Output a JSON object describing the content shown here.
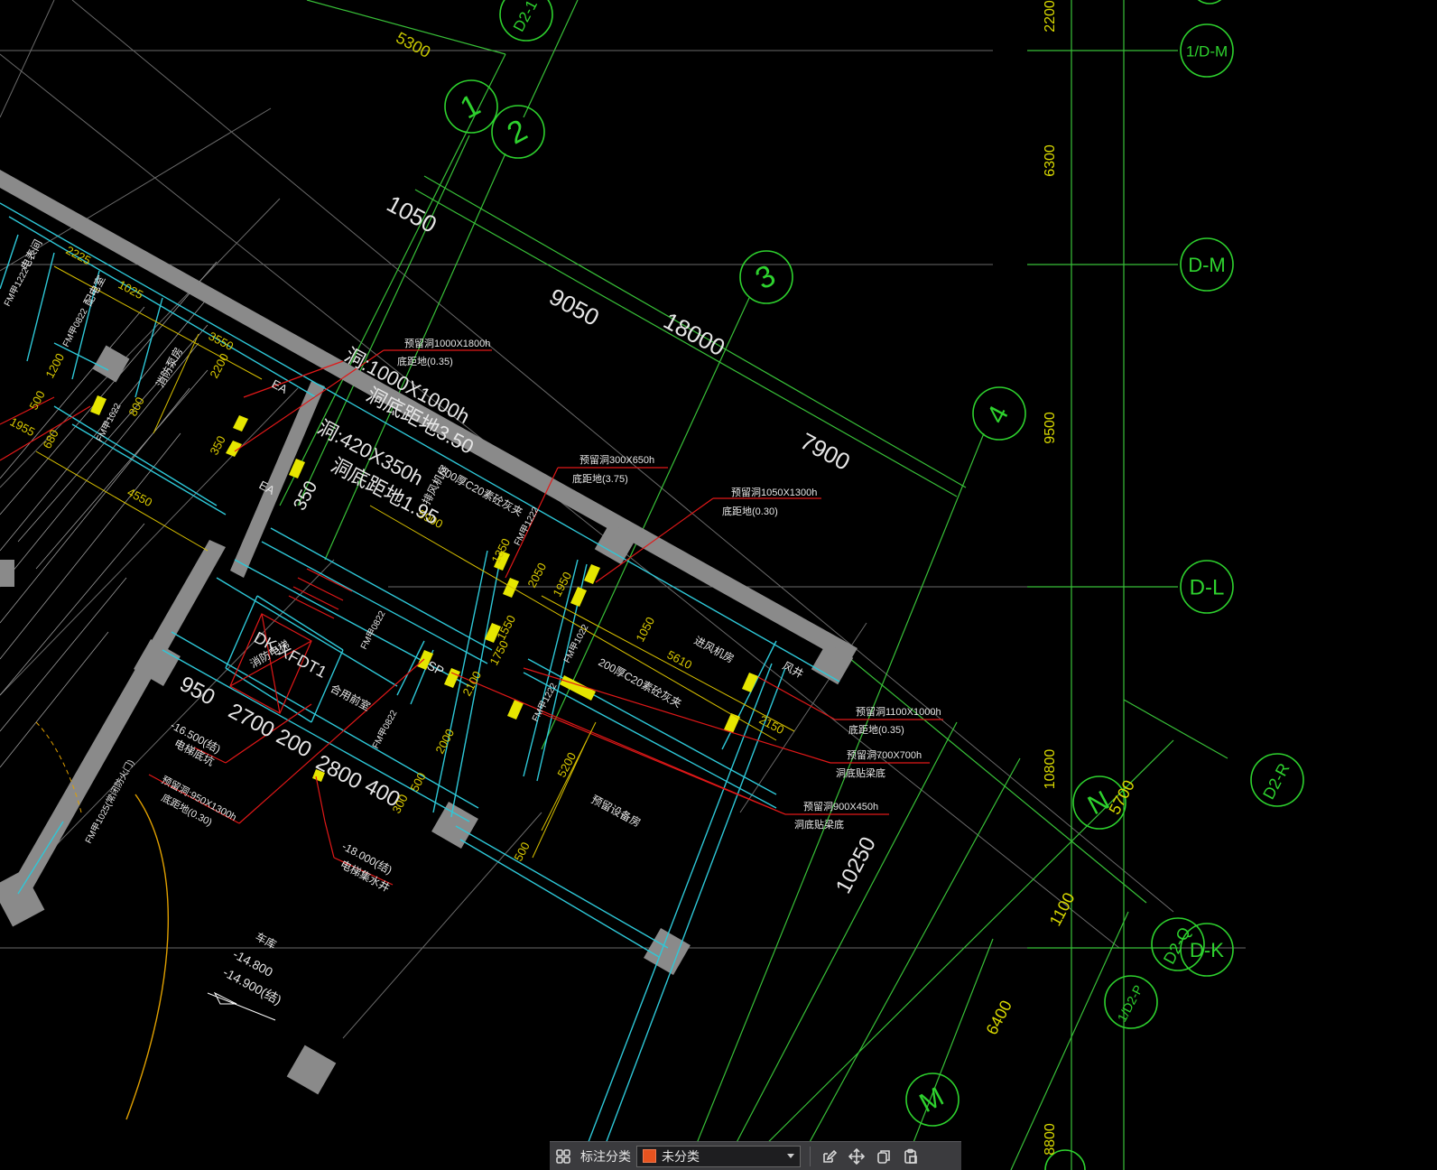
{
  "colors": {
    "axis_line": "#38c038",
    "axis_bubble": "#2ed22e",
    "dimension_text": "#e0e000",
    "wall_fill": "#8a8a8a",
    "structure_line": "#2ec8d8",
    "leader_line": "#e01818",
    "note_text": "#ffffff",
    "grid_line": "#7a7a7a",
    "toolbar_bg": "#3b3b3e",
    "category_swatch": "#e8531f"
  },
  "drawing": {
    "axis_bubbles": [
      "D2-1",
      "1",
      "2",
      "3",
      "4",
      "1/D-M",
      "D-M",
      "D-L",
      "D-K",
      "D2-R",
      "D2-Q",
      "1/D2-P",
      "N",
      "M"
    ],
    "dimensions": {
      "top_chain": [
        "5300",
        "1050",
        "9050",
        "18000",
        "7900"
      ],
      "right_chain": [
        "2200",
        "6300",
        "9500",
        "10800",
        "8800"
      ],
      "lower_right_chain": [
        "5700",
        "1100",
        "6400",
        "10250"
      ],
      "inner_yellow": [
        "2225",
        "1025",
        "3550",
        "2200",
        "1200",
        "800",
        "1955",
        "680",
        "4550",
        "500",
        "350",
        "5900",
        "1350",
        "2050",
        "1950",
        "1550",
        "1750",
        "2100",
        "5610",
        "1050",
        "2150",
        "5200",
        "2000",
        "500",
        "300",
        "500"
      ],
      "bottom_large": [
        "950",
        "2700",
        "200",
        "2800",
        "400"
      ]
    },
    "hole_notes": {
      "hole_large_1": "洞:1000X1000h",
      "hole_large_1_bottom": "洞底距地3.50",
      "hole_large_2": "洞:420X350h",
      "hole_large_2_bottom": "洞底距地1.95",
      "note_top_line1": "预留洞1000X1800h",
      "note_top_line2": "底距地(0.35)",
      "note_mid_line1": "预留洞300X650h",
      "note_mid_line2": "底距地(3.75)",
      "note_right_line1": "预留洞1050X1300h",
      "note_right_line2": "底距地(0.30)",
      "note_r2_line1": "预留洞1100X1000h",
      "note_r2_line2": "底距地(0.35)",
      "note_r3_line1": "预留洞700X700h",
      "note_r3_line2": "洞底贴梁底",
      "note_r4_line1": "预留洞900X450h",
      "note_r4_line2": "洞底贴梁底",
      "note_left_line1": "预留洞:950X1300h",
      "note_left_line2": "底距地(0.30)"
    },
    "elevations": {
      "elev_1": "-16.500(结)",
      "elev_1_label": "电梯底坑",
      "elev_2": "-18.000(结)",
      "elev_2_label": "电梯集水井",
      "ramp_title": "车库",
      "ramp_1": "-14.800",
      "ramp_2": "-14.900(结)"
    },
    "room_labels": [
      "电表间",
      "配电室",
      "消防泵房",
      "排风机房",
      "200厚C20素砼灰夹",
      "进风机房",
      "风井",
      "预留设备房",
      "合用前室",
      "消防电梯",
      "FM甲1222",
      "FM甲0822",
      "FM甲1022",
      "FM甲0822"
    ],
    "tags": {
      "equipment": "DK-XFDT1",
      "ea": "EA",
      "ea2": "EA",
      "sp": "SP",
      "stair": "FM甲1025(常闭防火门)"
    },
    "conc_note_2": "200厚C20素砼灰夹"
  },
  "toolbar": {
    "category_label": "标注分类",
    "category_value": "未分类",
    "icons": [
      "grid-view-icon",
      "edit-icon",
      "move-icon",
      "copy-icon",
      "paste-icon"
    ]
  }
}
